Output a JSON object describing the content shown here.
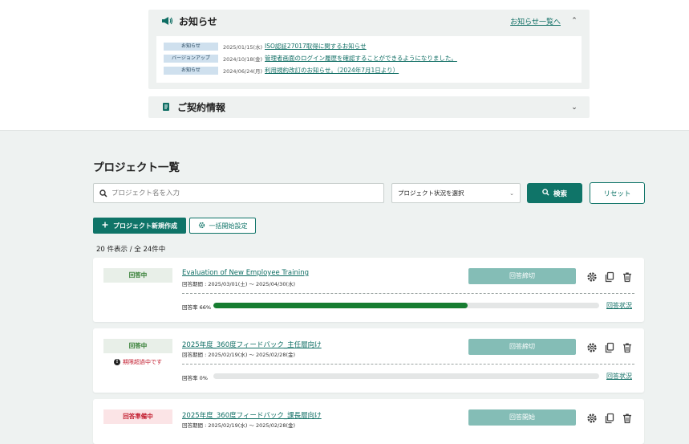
{
  "notices": {
    "title": "お知らせ",
    "list_link": "お知らせ一覧へ",
    "items": [
      {
        "tag": "お知らせ",
        "date": "2025/01/15(水)",
        "text": "ISO認証27017取得に関するお知らせ"
      },
      {
        "tag": "バージョンアップ",
        "date": "2024/10/18(金)",
        "text": "管理者画面のログイン履歴を確認することができるようになりました。"
      },
      {
        "tag": "お知らせ",
        "date": "2024/06/24(月)",
        "text": "利用規約改訂のお知らせ。（2024年7月1日より）"
      }
    ]
  },
  "contract": {
    "title": "ご契約情報"
  },
  "projects": {
    "title": "プロジェクト一覧",
    "search_placeholder": "プロジェクト名を入力",
    "status_select": "プロジェクト状況を選択",
    "search_button": "検索",
    "reset_button": "リセット",
    "new_button": "プロジェクト新規作成",
    "bulk_button": "一括開始設定",
    "count_text": "20 件表示 / 全 24件中",
    "items": [
      {
        "status": "回答中",
        "status_color": "green",
        "warning": "",
        "title": "Evaluation of New Employee Training",
        "period": "回答期間 : 2025/03/01(土) 〜 2025/04/30(水)",
        "action": "回答締切",
        "rate_label": "回答率 66%",
        "rate": 0.66,
        "response_link": "回答状況"
      },
      {
        "status": "回答中",
        "status_color": "green",
        "warning": "期限超過中です",
        "title": "2025年度_360度フィードバック_主任層向け",
        "period": "回答期間 : 2025/02/19(水) 〜 2025/02/28(金)",
        "action": "回答締切",
        "rate_label": "回答率 0%",
        "rate": 0.0,
        "response_link": "回答状況"
      },
      {
        "status": "回答準備中",
        "status_color": "red",
        "warning": "",
        "title": "2025年度_360度フィードバック_課長層向け",
        "period": "回答期間 : 2025/02/19(水) 〜 2025/02/28(金)",
        "action": "回答開始"
      }
    ]
  },
  "colors": {
    "primary": "#0f7468",
    "progress": "#177d31",
    "warning": "#c21c2e"
  }
}
